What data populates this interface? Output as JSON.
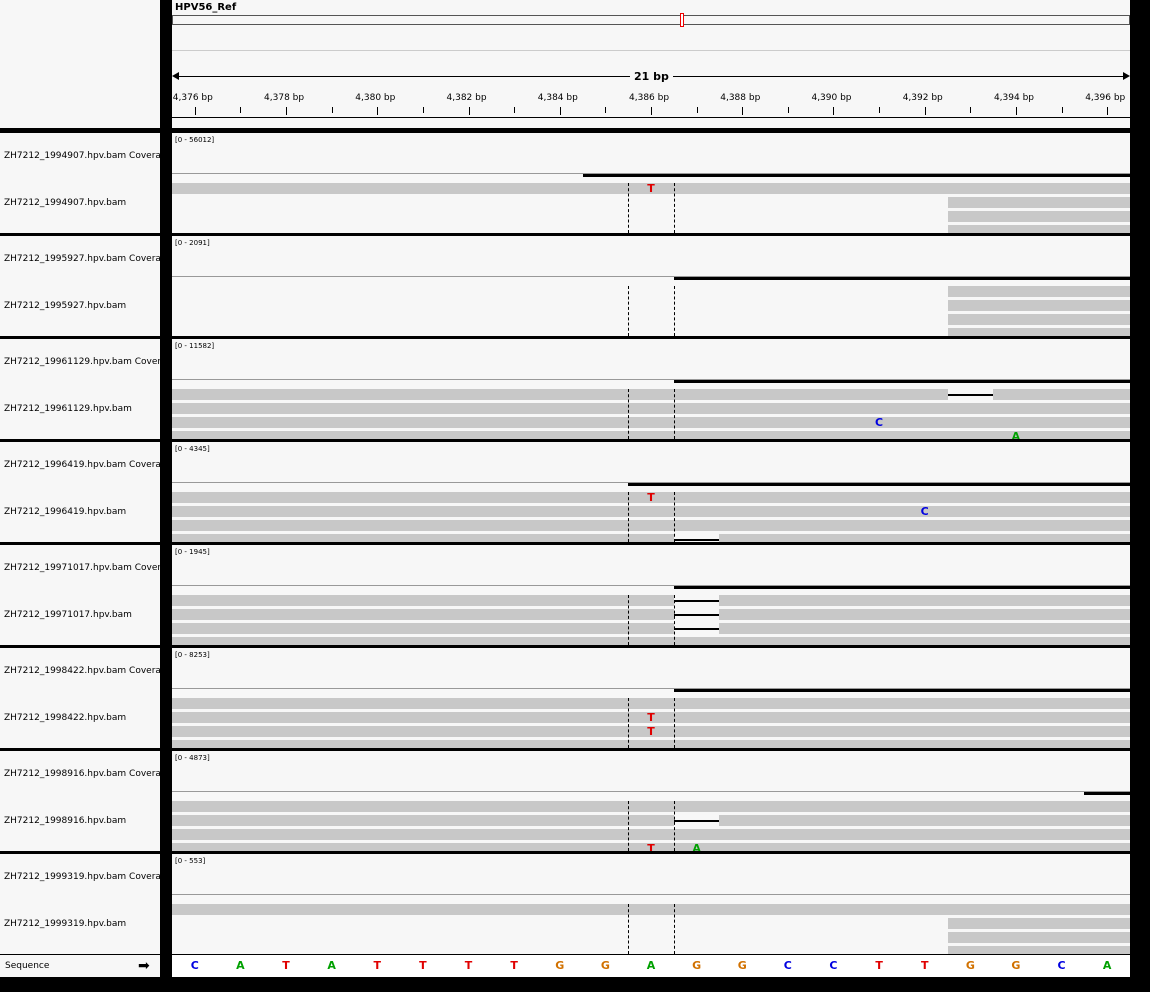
{
  "reference": {
    "chromosome": "HPV56_Ref",
    "span": "21 bp",
    "ticks": [
      "4,376 bp",
      "4,378 bp",
      "4,380 bp",
      "4,382 bp",
      "4,384 bp",
      "4,386 bp",
      "4,388 bp",
      "4,390 bp",
      "4,392 bp",
      "4,394 bp",
      "4,396 bp"
    ]
  },
  "tracks": [
    {
      "coverage_name": "ZH7212_1994907.hpv.bam Coverage",
      "reads_name": "ZH7212_1994907.hpv.bam",
      "range": "[0 - 56012]",
      "reads": [
        {
          "s": 0,
          "e": 21,
          "row": 0
        },
        {
          "s": 17,
          "e": 21,
          "row": 1
        },
        {
          "s": 17,
          "e": 21,
          "row": 2
        },
        {
          "s": 17,
          "e": 21,
          "row": 3
        }
      ],
      "coverage": {
        "s": 9,
        "e": 21
      },
      "mismatches": [
        {
          "base": "T",
          "col": 10,
          "row": 0
        }
      ],
      "deletions": []
    },
    {
      "coverage_name": "ZH7212_1995927.hpv.bam Coverage",
      "reads_name": "ZH7212_1995927.hpv.bam",
      "range": "[0 - 2091]",
      "reads": [
        {
          "s": 17,
          "e": 21,
          "row": 0
        },
        {
          "s": 17,
          "e": 21,
          "row": 1
        },
        {
          "s": 17,
          "e": 21,
          "row": 2
        },
        {
          "s": 17,
          "e": 21,
          "row": 3
        }
      ],
      "coverage": {
        "s": 11,
        "e": 21
      },
      "mismatches": [],
      "deletions": []
    },
    {
      "coverage_name": "ZH7212_19961129.hpv.bam Coverage",
      "reads_name": "ZH7212_19961129.hpv.bam",
      "range": "[0 - 11582]",
      "reads": [
        {
          "s": 0,
          "e": 21,
          "row": 0
        },
        {
          "s": 0,
          "e": 21,
          "row": 1
        },
        {
          "s": 0,
          "e": 21,
          "row": 2
        },
        {
          "s": 0,
          "e": 21,
          "row": 3
        }
      ],
      "coverage": {
        "s": 11,
        "e": 21
      },
      "mismatches": [
        {
          "base": "C",
          "col": 15,
          "row": 2
        },
        {
          "base": "A",
          "col": 18,
          "row": 3
        }
      ],
      "deletions": [
        {
          "s": 17,
          "e": 18,
          "row": 0
        }
      ]
    },
    {
      "coverage_name": "ZH7212_1996419.hpv.bam Coverage",
      "reads_name": "ZH7212_1996419.hpv.bam",
      "range": "[0 - 4345]",
      "reads": [
        {
          "s": 0,
          "e": 21,
          "row": 0
        },
        {
          "s": 0,
          "e": 21,
          "row": 1
        },
        {
          "s": 0,
          "e": 21,
          "row": 2
        },
        {
          "s": 0,
          "e": 21,
          "row": 3
        }
      ],
      "coverage": {
        "s": 10,
        "e": 21
      },
      "mismatches": [
        {
          "base": "T",
          "col": 10,
          "row": 0
        },
        {
          "base": "C",
          "col": 16,
          "row": 1
        }
      ],
      "deletions": [
        {
          "s": 11,
          "e": 12,
          "row": 3
        }
      ]
    },
    {
      "coverage_name": "ZH7212_19971017.hpv.bam Coverage",
      "reads_name": "ZH7212_19971017.hpv.bam",
      "range": "[0 - 1945]",
      "reads": [
        {
          "s": 0,
          "e": 21,
          "row": 0
        },
        {
          "s": 0,
          "e": 21,
          "row": 1
        },
        {
          "s": 0,
          "e": 21,
          "row": 2
        },
        {
          "s": 0,
          "e": 21,
          "row": 3
        }
      ],
      "coverage": {
        "s": 11,
        "e": 21
      },
      "mismatches": [],
      "deletions": [
        {
          "s": 11,
          "e": 12,
          "row": 0
        },
        {
          "s": 11,
          "e": 12,
          "row": 1
        },
        {
          "s": 11,
          "e": 12,
          "row": 2
        }
      ]
    },
    {
      "coverage_name": "ZH7212_1998422.hpv.bam Coverage",
      "reads_name": "ZH7212_1998422.hpv.bam",
      "range": "[0 - 8253]",
      "reads": [
        {
          "s": 0,
          "e": 21,
          "row": 0
        },
        {
          "s": 0,
          "e": 21,
          "row": 1
        },
        {
          "s": 0,
          "e": 21,
          "row": 2
        },
        {
          "s": 0,
          "e": 21,
          "row": 3
        }
      ],
      "coverage": {
        "s": 11,
        "e": 21
      },
      "mismatches": [
        {
          "base": "T",
          "col": 10,
          "row": 1
        },
        {
          "base": "T",
          "col": 10,
          "row": 2
        }
      ],
      "deletions": []
    },
    {
      "coverage_name": "ZH7212_1998916.hpv.bam Coverage",
      "reads_name": "ZH7212_1998916.hpv.bam",
      "range": "[0 - 4873]",
      "reads": [
        {
          "s": 0,
          "e": 21,
          "row": 0
        },
        {
          "s": 0,
          "e": 21,
          "row": 1
        },
        {
          "s": 0,
          "e": 21,
          "row": 2
        },
        {
          "s": 0,
          "e": 21,
          "row": 3
        }
      ],
      "coverage": {
        "s": 20,
        "e": 21
      },
      "mismatches": [
        {
          "base": "T",
          "col": 10,
          "row": 3
        },
        {
          "base": "A",
          "col": 11,
          "row": 3
        }
      ],
      "deletions": [
        {
          "s": 11,
          "e": 12,
          "row": 1
        }
      ]
    },
    {
      "coverage_name": "ZH7212_1999319.hpv.bam Coverage",
      "reads_name": "ZH7212_1999319.hpv.bam",
      "range": "[0 - 553]",
      "reads": [
        {
          "s": 0,
          "e": 21,
          "row": 0
        },
        {
          "s": 17,
          "e": 21,
          "row": 1
        },
        {
          "s": 17,
          "e": 21,
          "row": 2
        },
        {
          "s": 17,
          "e": 21,
          "row": 3
        }
      ],
      "coverage": null,
      "mismatches": [],
      "deletions": []
    }
  ],
  "sequence": {
    "label": "Sequence",
    "arrow": "➡",
    "bases": [
      "C",
      "A",
      "T",
      "A",
      "T",
      "T",
      "T",
      "T",
      "G",
      "G",
      "A",
      "G",
      "G",
      "C",
      "C",
      "T",
      "T",
      "G",
      "G",
      "C",
      "A"
    ]
  },
  "colors": {
    "A": "#00a000",
    "C": "#0000e0",
    "G": "#d17100",
    "T": "#e00000",
    "read": "#c8c8c8",
    "panel": "#f7f7f7"
  }
}
